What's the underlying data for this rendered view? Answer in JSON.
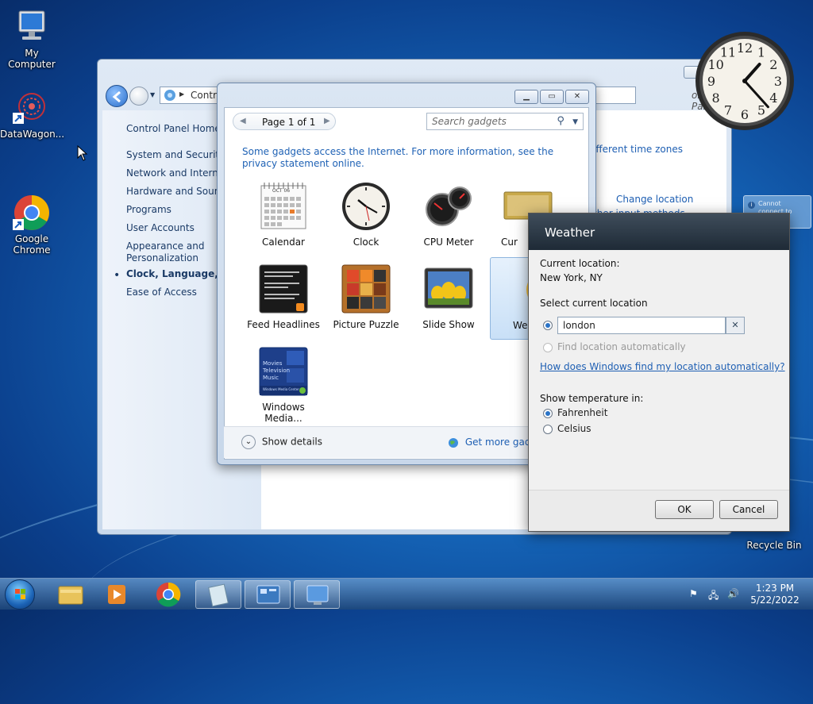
{
  "desktop": {
    "icons": [
      {
        "label": "My Computer"
      },
      {
        "label": "DataWagon..."
      },
      {
        "label": "Google\nChrome"
      },
      {
        "label": "Recycle Bin"
      }
    ]
  },
  "control_panel": {
    "address": "Control Panel",
    "address_tail": "ol Panel",
    "sidebar": [
      {
        "label": "Control Panel Home"
      },
      {
        "label": "System and Security"
      },
      {
        "label": "Network and Internet"
      },
      {
        "label": "Hardware and Sound"
      },
      {
        "label": "Programs"
      },
      {
        "label": "User Accounts"
      },
      {
        "label": "Appearance and\nPersonalization"
      },
      {
        "label": "Clock, Language, and"
      },
      {
        "label": "Ease of Access"
      }
    ],
    "right_links": {
      "time_zones": "ifferent time zones",
      "change_location": "Change location",
      "input_methods": "ther input methods",
      "partial_e": "e"
    }
  },
  "gallery": {
    "page_label": "Page 1 of 1",
    "search_placeholder": "Search gadgets",
    "info_text": "Some gadgets access the Internet.  For more information, see the privacy statement online.",
    "gadgets": [
      {
        "label": "Calendar"
      },
      {
        "label": "Clock"
      },
      {
        "label": "CPU Meter"
      },
      {
        "label": "Cur"
      },
      {
        "label": "Feed Headlines"
      },
      {
        "label": "Picture Puzzle"
      },
      {
        "label": "Slide Show"
      },
      {
        "label": "We"
      },
      {
        "label": "Windows Media..."
      }
    ],
    "calendar_month": "OCT 06",
    "media_lines": [
      "Movies",
      "Television",
      "Music",
      "Windows Media Center"
    ],
    "show_details": "Show details",
    "get_more": "Get more gadg"
  },
  "weather": {
    "title": "Weather",
    "current_location_label": "Current location:",
    "current_location_value": "New York, NY",
    "select_label": "Select current location",
    "location_input": "london",
    "find_auto": "Find location automatically",
    "how_link": "How does Windows find my location automatically?",
    "temp_label": "Show temperature in:",
    "fahrenheit": "Fahrenheit",
    "celsius": "Celsius",
    "ok": "OK",
    "cancel": "Cancel"
  },
  "notification": {
    "text": "Cannot connect to service"
  },
  "clock": {
    "hour": 1,
    "minute": 23,
    "numbers": [
      "12",
      "1",
      "2",
      "3",
      "4",
      "5",
      "6",
      "7",
      "8",
      "9",
      "10",
      "11"
    ]
  },
  "taskbar": {
    "time": "1:23 PM",
    "date": "5/22/2022"
  },
  "colors": {
    "link": "#1e5fb3",
    "title_bar": "#1e2a36",
    "accent": "#2a73c7"
  }
}
